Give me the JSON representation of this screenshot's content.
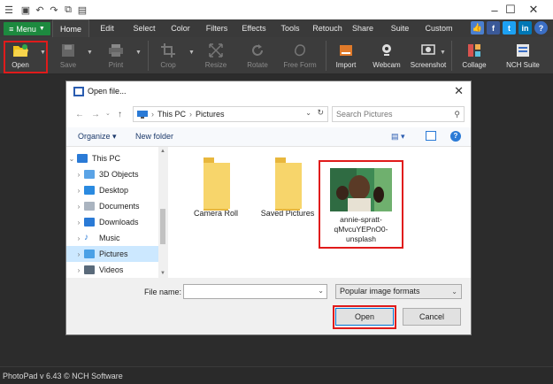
{
  "app": {
    "status": "PhotoPad v 6.43 © NCH Software"
  },
  "menu": {
    "menu_label": "Menu",
    "tabs": [
      "Home",
      "Edit",
      "Select",
      "Color",
      "Filters",
      "Effects",
      "Tools",
      "Retouch",
      "Share",
      "Suite",
      "Custom"
    ]
  },
  "toolbar": {
    "open": "Open",
    "save": "Save",
    "print": "Print",
    "crop": "Crop",
    "resize": "Resize",
    "rotate": "Rotate",
    "free_form": "Free Form",
    "import": "Import",
    "webcam": "Webcam",
    "screenshot": "Screenshot",
    "collage": "Collage",
    "nch_suite": "NCH Suite"
  },
  "dialog": {
    "title": "Open file...",
    "breadcrumb": [
      "This PC",
      "Pictures"
    ],
    "search_placeholder": "Search Pictures",
    "organize": "Organize",
    "new_folder": "New folder",
    "nav_items": [
      "This PC",
      "3D Objects",
      "Desktop",
      "Documents",
      "Downloads",
      "Music",
      "Pictures",
      "Videos"
    ],
    "files": [
      {
        "name": "Camera Roll"
      },
      {
        "name": "Saved Pictures"
      },
      {
        "name": "annie-spratt-qMvcuYEPnO0-unsplash"
      }
    ],
    "file_name_label": "File name:",
    "file_name_value": "",
    "filter": "Popular image formats",
    "open_button": "Open",
    "cancel_button": "Cancel"
  },
  "colors": {
    "menu_green": "#1d8a3f",
    "highlight_red": "#e01b1b",
    "selection_blue": "#cce8ff"
  }
}
